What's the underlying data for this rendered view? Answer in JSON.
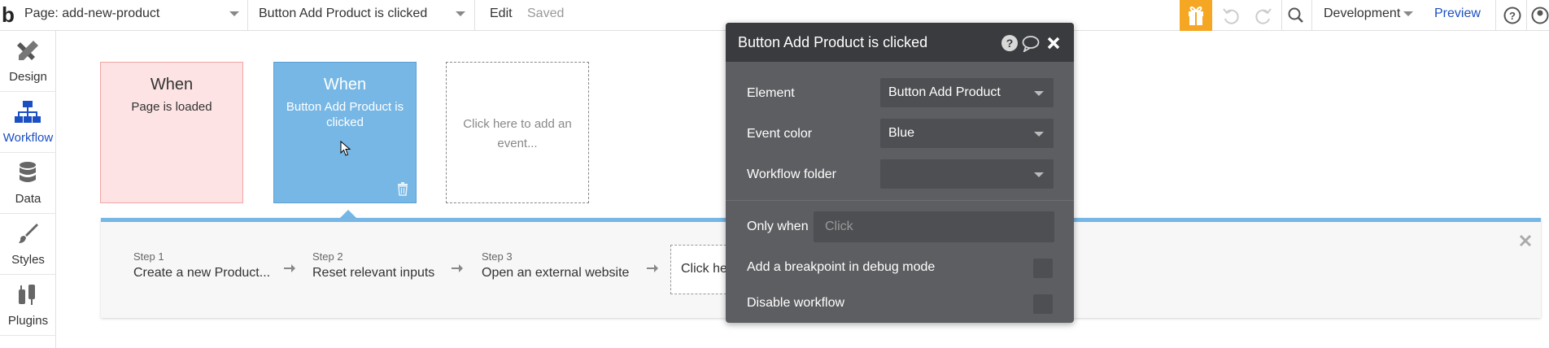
{
  "topbar": {
    "logo": "b",
    "page_selector": "Page: add-new-product",
    "workflow_selector": "Button Add Product is clicked",
    "edit_label": "Edit",
    "saved_label": "Saved",
    "environment": "Development",
    "preview_label": "Preview",
    "accent_color": "#f5a623"
  },
  "sidebar": {
    "items": [
      {
        "label": "Design",
        "icon": "design-icon"
      },
      {
        "label": "Workflow",
        "icon": "workflow-icon"
      },
      {
        "label": "Data",
        "icon": "data-icon"
      },
      {
        "label": "Styles",
        "icon": "brush-icon"
      },
      {
        "label": "Plugins",
        "icon": "plug-icon"
      }
    ],
    "active_color": "#1c4fc3"
  },
  "events": [
    {
      "when": "When",
      "description": "Page is loaded",
      "color": "#fde3e3"
    },
    {
      "when": "When",
      "description": "Button Add Product is clicked",
      "color": "#77b7e5"
    }
  ],
  "add_event_text": "Click here to add an event...",
  "steps": [
    {
      "num": "Step 1",
      "name": "Create a new Product..."
    },
    {
      "num": "Step 2",
      "name": "Reset relevant inputs"
    },
    {
      "num": "Step 3",
      "name": "Open an external website"
    }
  ],
  "add_action_text": "Click her",
  "panel": {
    "title": "Button Add Product is clicked",
    "element_label": "Element",
    "element_value": "Button Add Product",
    "event_color_label": "Event color",
    "event_color_value": "Blue",
    "folder_label": "Workflow folder",
    "folder_value": "",
    "only_when_label": "Only when",
    "only_when_placeholder": "Click",
    "breakpoint_label": "Add a breakpoint in debug mode",
    "disable_label": "Disable workflow"
  }
}
